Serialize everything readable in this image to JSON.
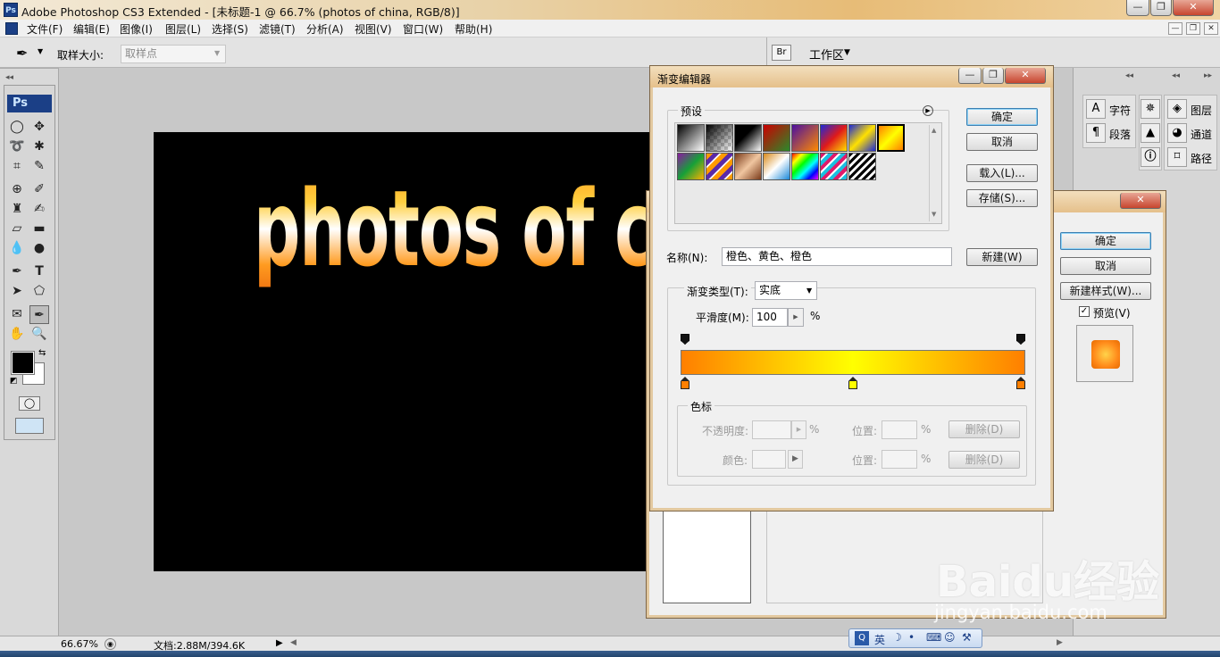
{
  "app": {
    "logo": "Ps",
    "title": "Adobe Photoshop CS3 Extended - [未标题-1 @ 66.7% (photos  of china, RGB/8)]"
  },
  "window_controls": {
    "minimize": "—",
    "restore": "❐",
    "close": "✕"
  },
  "menu": [
    "文件(F)",
    "编辑(E)",
    "图像(I)",
    "图层(L)",
    "选择(S)",
    "滤镜(T)",
    "分析(A)",
    "视图(V)",
    "窗口(W)",
    "帮助(H)"
  ],
  "options_bar": {
    "sample_size_label": "取样大小:",
    "sample_size_value": "取样点",
    "workspace_label": "工作区"
  },
  "canvas": {
    "text": "photos  of china"
  },
  "status": {
    "zoom": "66.67%",
    "doc": "文档:2.88M/394.6K"
  },
  "gradient_editor": {
    "title": "渐变编辑器",
    "presets_label": "预设",
    "ok": "确定",
    "cancel": "取消",
    "load": "载入(L)...",
    "save": "存储(S)...",
    "name_label": "名称(N):",
    "name_value": "橙色、黄色、橙色",
    "new": "新建(W)",
    "type_label": "渐变类型(T):",
    "type_value": "实底",
    "smoothness_label": "平滑度(M):",
    "smoothness_value": "100",
    "percent": "%",
    "stops_label": "色标",
    "opacity_label": "不透明度:",
    "location_label": "位置:",
    "delete": "删除(D)",
    "color_label": "颜色:",
    "color_stops": [
      {
        "location": 0,
        "color": "#ff7f00"
      },
      {
        "location": 50,
        "color": "#ffff00"
      },
      {
        "location": 100,
        "color": "#ff7f00"
      }
    ]
  },
  "layer_style_dialog": {
    "ok": "确定",
    "cancel": "取消",
    "new_style": "新建样式(W)...",
    "preview_label": "预览(V)",
    "preview_checked": true
  },
  "panels": {
    "character": "字符",
    "paragraph": "段落",
    "layers": "图层",
    "channels": "通道",
    "paths": "路径"
  },
  "ime_bar": {
    "lang": "英"
  },
  "watermark": {
    "brand": "Baidu经验",
    "url": "jingyan.baidu.com"
  }
}
